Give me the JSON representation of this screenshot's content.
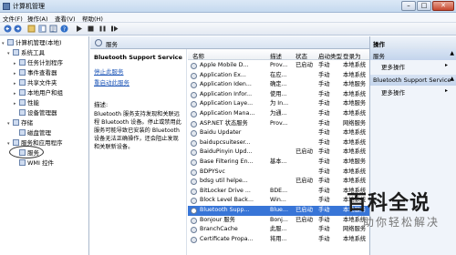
{
  "window": {
    "title": "计算机管理"
  },
  "menu": [
    "文件(F)",
    "操作(A)",
    "查看(V)",
    "帮助(H)"
  ],
  "tree": [
    {
      "label": "计算机管理(本地)",
      "expand": "▾"
    },
    {
      "label": "系统工具",
      "expand": "▾"
    },
    {
      "label": "任务计划程序",
      "expand": "▸"
    },
    {
      "label": "事件查看器",
      "expand": "▸"
    },
    {
      "label": "共享文件夹",
      "expand": "▸"
    },
    {
      "label": "本地用户和组",
      "expand": "▸"
    },
    {
      "label": "性能",
      "expand": "▸"
    },
    {
      "label": "设备管理器",
      "expand": ""
    },
    {
      "label": "存储",
      "expand": "▾"
    },
    {
      "label": "磁盘管理",
      "expand": ""
    },
    {
      "label": "服务和应用程序",
      "expand": "▾"
    },
    {
      "label": "服务",
      "expand": ""
    },
    {
      "label": "WMI 控件",
      "expand": ""
    }
  ],
  "header": {
    "title": "服务"
  },
  "detail": {
    "service_name": "Bluetooth Support Service",
    "stop_link": "停止此服务",
    "restart_link": "重启动此服务",
    "desc_label": "描述:",
    "description": "Bluetooth 服务支持发现和关联远程 Bluetooth 设备。停止或禁用此服务可能导致已安装的 Bluetooth 设备无法正确操作，还会阻止发现和关联新设备。"
  },
  "columns": {
    "name": "名称",
    "desc": "描述",
    "status": "状态",
    "startup": "启动类型",
    "logon": "登录为"
  },
  "services": [
    {
      "name": "Apple Mobile D...",
      "desc": "Prov...",
      "status": "已启动",
      "startup": "手动",
      "logon": "本地系统"
    },
    {
      "name": "Application Ex...",
      "desc": "在应...",
      "status": "",
      "startup": "手动",
      "logon": "本地系统"
    },
    {
      "name": "Application Iden...",
      "desc": "确定...",
      "status": "",
      "startup": "手动",
      "logon": "本地服务"
    },
    {
      "name": "Application Infor...",
      "desc": "使用...",
      "status": "",
      "startup": "手动",
      "logon": "本地系统"
    },
    {
      "name": "Application Laye...",
      "desc": "为 In...",
      "status": "",
      "startup": "手动",
      "logon": "本地服务"
    },
    {
      "name": "Application Mana...",
      "desc": "为通...",
      "status": "",
      "startup": "手动",
      "logon": "本地系统"
    },
    {
      "name": "ASP.NET 状态服务",
      "desc": "Prov...",
      "status": "",
      "startup": "手动",
      "logon": "网络服务"
    },
    {
      "name": "Baidu Updater",
      "desc": "",
      "status": "",
      "startup": "手动",
      "logon": "本地系统"
    },
    {
      "name": "baidupcsuiteser...",
      "desc": "",
      "status": "",
      "startup": "手动",
      "logon": "本地系统"
    },
    {
      "name": "BaiduPinyin Upd...",
      "desc": "",
      "status": "已启动",
      "startup": "手动",
      "logon": "本地系统"
    },
    {
      "name": "Base Filtering En...",
      "desc": "基本...",
      "status": "",
      "startup": "手动",
      "logon": "本地服务"
    },
    {
      "name": "BDPYSvc",
      "desc": "",
      "status": "",
      "startup": "手动",
      "logon": "本地系统"
    },
    {
      "name": "bdsg util helpe...",
      "desc": "",
      "status": "已启动",
      "startup": "手动",
      "logon": "本地系统"
    },
    {
      "name": "BitLocker Drive ...",
      "desc": "BDE...",
      "status": "",
      "startup": "手动",
      "logon": "本地系统"
    },
    {
      "name": "Block Level Back...",
      "desc": "Win...",
      "status": "",
      "startup": "手动",
      "logon": "本地系统"
    },
    {
      "name": "Bluetooth Supp...",
      "desc": "Blue...",
      "status": "已启动",
      "startup": "手动",
      "logon": "本地服务",
      "selected": true
    },
    {
      "name": "Bonjour 服务",
      "desc": "Bonj...",
      "status": "已启动",
      "startup": "手动",
      "logon": "本地系统"
    },
    {
      "name": "BranchCache",
      "desc": "此服...",
      "status": "",
      "startup": "手动",
      "logon": "网络服务"
    },
    {
      "name": "Certificate Propa...",
      "desc": "将用...",
      "status": "",
      "startup": "手动",
      "logon": "本地系统"
    }
  ],
  "actions": {
    "title": "操作",
    "section1": "服务",
    "more1": "更多操作",
    "section2": "Bluetooth Support Service",
    "more2": "更多操作"
  },
  "watermark": {
    "logo": "百科全说",
    "sub": "助你轻松解决"
  },
  "icons": {
    "title": "computer-management-icon",
    "toolbar": [
      "back-icon",
      "forward-icon",
      "up-icon",
      "show-hide-icon",
      "properties-icon",
      "help-icon",
      "play-icon",
      "stop-icon",
      "pause-icon",
      "restart-icon"
    ],
    "tree_item": "folder-icon",
    "service": "gear-icon"
  }
}
